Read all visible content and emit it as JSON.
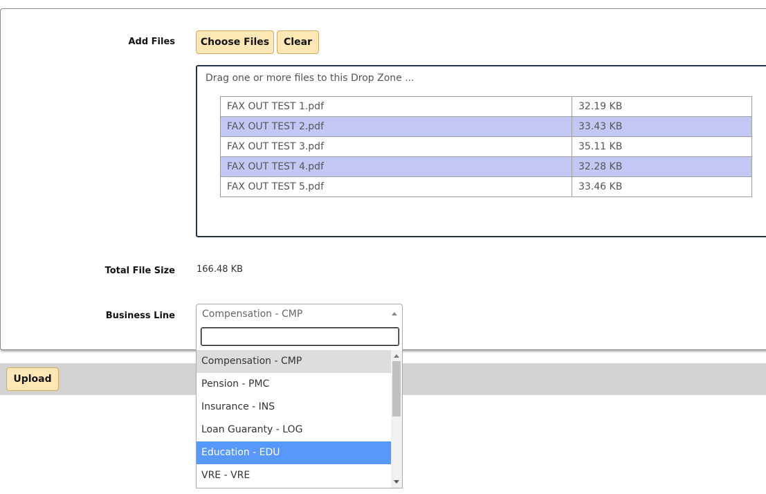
{
  "form": {
    "add_files_label": "Add Files",
    "choose_files_label": "Choose Files",
    "clear_label": "Clear",
    "dropzone_hint": "Drag one or more files to this Drop Zone ...",
    "files": [
      {
        "name": "FAX OUT TEST 1.pdf",
        "size": "32.19 KB",
        "selected": false
      },
      {
        "name": "FAX OUT TEST 2.pdf",
        "size": "33.43 KB",
        "selected": true
      },
      {
        "name": "FAX OUT TEST 3.pdf",
        "size": "35.11 KB",
        "selected": false
      },
      {
        "name": "FAX OUT TEST 4.pdf",
        "size": "32.28 KB",
        "selected": true
      },
      {
        "name": "FAX OUT TEST 5.pdf",
        "size": "33.46 KB",
        "selected": false
      }
    ],
    "total_file_size_label": "Total File Size",
    "total_file_size_value": "166.48 KB",
    "business_line_label": "Business Line",
    "business_line_selected": "Compensation - CMP",
    "business_line_search_value": "",
    "business_line_options": [
      "Compensation - CMP",
      "Pension - PMC",
      "Insurance - INS",
      "Loan Guaranty - LOG",
      "Education - EDU",
      "VRE - VRE"
    ],
    "highlighted_option": "Education - EDU"
  },
  "footer": {
    "upload_label": "Upload"
  },
  "colors": {
    "button_bg": "#fde7b5",
    "selected_row": "#c2c8f3",
    "highlight_option": "#5897fb",
    "footer_bar": "#d3d3d3"
  }
}
